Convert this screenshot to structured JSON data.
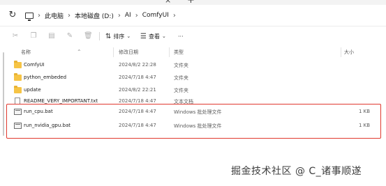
{
  "tabbar": {
    "close_glyph": "×",
    "new_tab_glyph": "+"
  },
  "nav": {
    "refresh_icon": "refresh-icon",
    "this_pc_icon": "computer-icon",
    "breadcrumb": [
      "此电脑",
      "本地磁盘 (D:)",
      "AI",
      "ComfyUI"
    ]
  },
  "toolbar": {
    "sort_label": "排序",
    "view_label": "查看",
    "more_label": "···"
  },
  "columns": {
    "name": "名称",
    "date": "修改日期",
    "type": "类型",
    "size": "大小"
  },
  "files": [
    {
      "name": "ComfyUI",
      "date": "2024/8/2 22:28",
      "type": "文件夹",
      "size": "",
      "icon": "folder-icon"
    },
    {
      "name": "python_embeded",
      "date": "2024/7/18 4:47",
      "type": "文件夹",
      "size": "",
      "icon": "folder-icon"
    },
    {
      "name": "update",
      "date": "2024/8/2 22:21",
      "type": "文件夹",
      "size": "",
      "icon": "folder-icon"
    },
    {
      "name": "README_VERY_IMPORTANT.txt",
      "date": "2024/7/18 4:47",
      "type": "文本文档",
      "size": "",
      "icon": "text-file-icon"
    },
    {
      "name": "run_cpu.bat",
      "date": "2024/7/18 4:47",
      "type": "Windows 批处理文件",
      "size": "1 KB",
      "icon": "batch-file-icon"
    },
    {
      "name": "run_nvidia_gpu.bat",
      "date": "2024/7/18 4:47",
      "type": "Windows 批处理文件",
      "size": "1 KB",
      "icon": "batch-file-icon"
    }
  ],
  "highlight_color": "#e0382e",
  "watermark": "掘金技术社区 @ C_诸事顺遂"
}
